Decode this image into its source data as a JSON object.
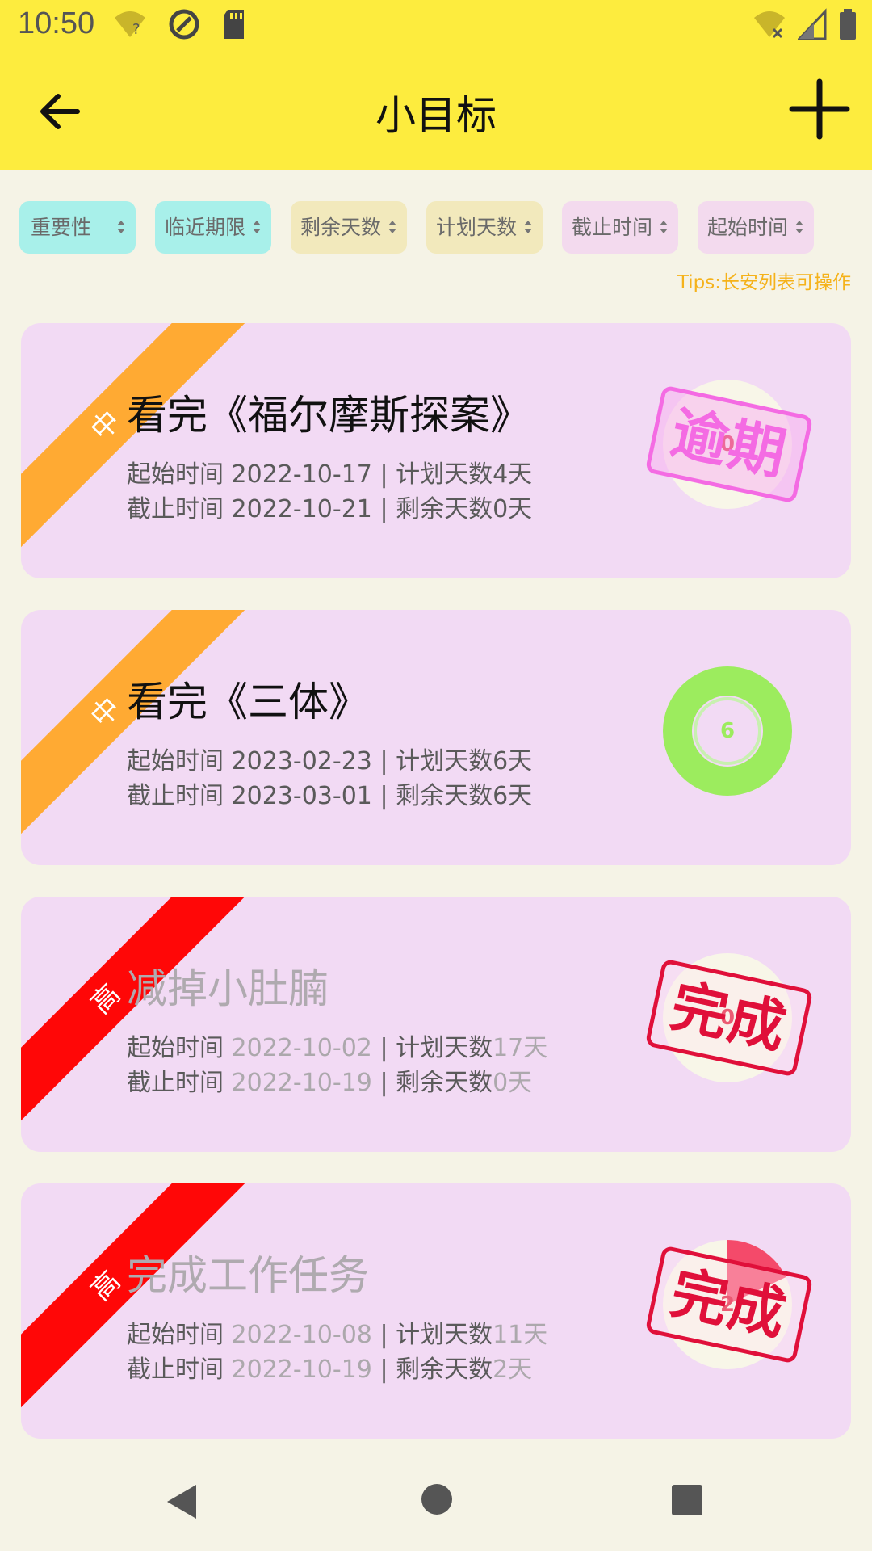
{
  "status_bar": {
    "time": "10:50",
    "icons_left": [
      "wifi-question-icon",
      "at-sign-icon",
      "sd-card-icon"
    ],
    "icons_right": [
      "wifi-off-icon",
      "signal-icon",
      "battery-icon"
    ]
  },
  "app_bar": {
    "title": "小目标",
    "back_icon": "arrow-left-icon",
    "add_icon": "plus-icon"
  },
  "sort_chips": [
    {
      "label": "重要性",
      "color": "#A8F0EA"
    },
    {
      "label": "临近期限",
      "color": "#A8F0EA"
    },
    {
      "label": "剩余天数",
      "color": "#F2E9BC"
    },
    {
      "label": "计划天数",
      "color": "#F2E9BC"
    },
    {
      "label": "截止时间",
      "color": "#F3DAEE"
    },
    {
      "label": "起始时间",
      "color": "#F3DAEE"
    }
  ],
  "tips": "Tips:长安列表可操作",
  "goals": [
    {
      "priority": "中",
      "priority_color": "#FFAA33",
      "title": "看完《福尔摩斯探案》",
      "start_label": "起始时间",
      "start_date": "2022-10-17",
      "plan_label": "计划天数",
      "plan_days": "4天",
      "end_label": "截止时间",
      "end_date": "2022-10-21",
      "remain_label": "剩余天数",
      "remain_days": "0天",
      "ring_value": "0",
      "stamp": "逾期",
      "status": "overdue"
    },
    {
      "priority": "中",
      "priority_color": "#FFAA33",
      "title": "看完《三体》",
      "start_label": "起始时间",
      "start_date": "2023-02-23",
      "plan_label": "计划天数",
      "plan_days": "6天",
      "end_label": "截止时间",
      "end_date": "2023-03-01",
      "remain_label": "剩余天数",
      "remain_days": "6天",
      "ring_value": "6",
      "ring_color": "#9CEC5E",
      "status": "active"
    },
    {
      "priority": "高",
      "priority_color": "#FF0707",
      "title": "减掉小肚腩",
      "start_label": "起始时间",
      "start_date": "2022-10-02",
      "plan_label": "计划天数",
      "plan_days": "17天",
      "end_label": "截止时间",
      "end_date": "2022-10-19",
      "remain_label": "剩余天数",
      "remain_days": "0天",
      "ring_value": "0",
      "stamp": "完成",
      "status": "done"
    },
    {
      "priority": "高",
      "priority_color": "#FF0707",
      "title": "完成工作任务",
      "start_label": "起始时间",
      "start_date": "2022-10-08",
      "plan_label": "计划天数",
      "plan_days": "11天",
      "end_label": "截止时间",
      "end_date": "2022-10-19",
      "remain_label": "剩余天数",
      "remain_days": "2天",
      "ring_value": "2",
      "ring_fill_fraction": 0.18,
      "stamp": "完成",
      "status": "done"
    }
  ],
  "nav_bar": {
    "icons": [
      "nav-back-icon",
      "nav-home-icon",
      "nav-recent-icon"
    ]
  }
}
